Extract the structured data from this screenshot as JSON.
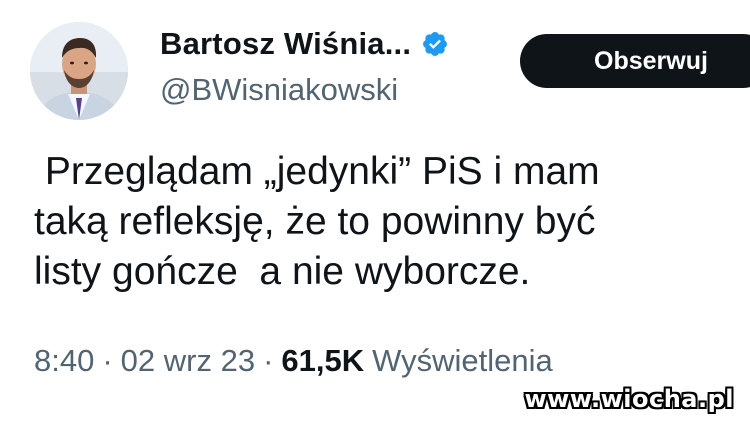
{
  "author": {
    "display_name": "Bartosz Wiśnia...",
    "handle": "@BWisniakowski",
    "verified": true,
    "avatar_icon": "profile-photo"
  },
  "follow_button": {
    "label": "Obserwuj"
  },
  "tweet": {
    "lines": [
      " Przeglądam „jedynki” PiS i mam",
      "taką refleksję, że to powinny być",
      "listy gończe  a nie wyborcze."
    ]
  },
  "meta": {
    "time": "8:40",
    "separator": "·",
    "date": "02 wrz 23",
    "views_count": "61,5K",
    "views_label": "Wyświetlenia"
  },
  "watermark": {
    "text": "www.wiocha.pl"
  },
  "colors": {
    "text_primary": "#0f1419",
    "text_secondary": "#536471",
    "verified": "#1d9bf0",
    "button_bg": "#0f1419",
    "button_text": "#ffffff"
  }
}
